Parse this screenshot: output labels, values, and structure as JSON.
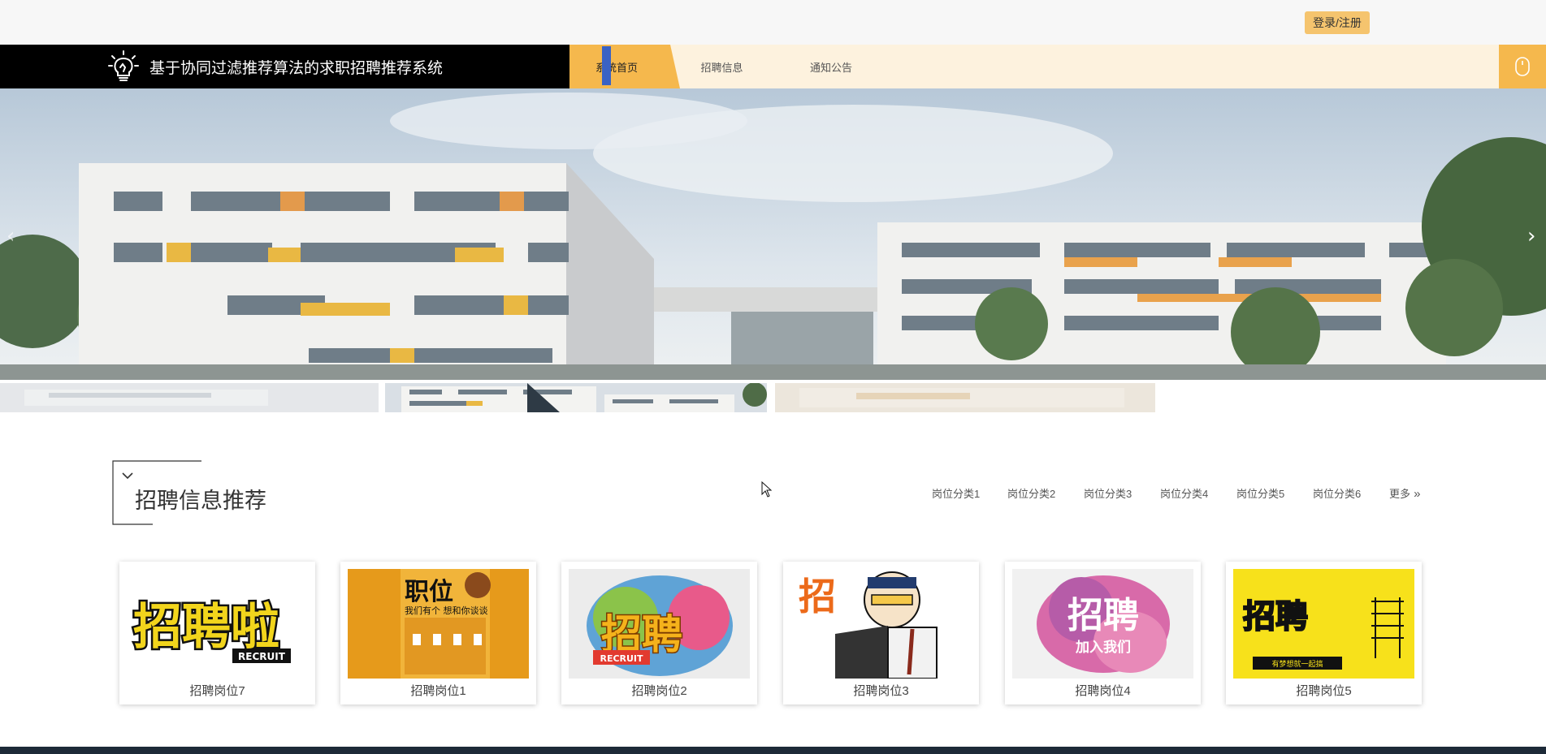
{
  "header": {
    "login_label": "登录/注册"
  },
  "nav": {
    "brand_title": "基于协同过滤推荐算法的求职招聘推荐系统",
    "tabs": [
      {
        "label": "系统首页",
        "active": true
      },
      {
        "label": "招聘信息",
        "active": false
      },
      {
        "label": "通知公告",
        "active": false
      }
    ]
  },
  "section": {
    "title": "招聘信息推荐",
    "categories": [
      "岗位分类1",
      "岗位分类2",
      "岗位分类3",
      "岗位分类4",
      "岗位分类5",
      "岗位分类6"
    ],
    "more_label": "更多"
  },
  "cards": [
    {
      "label": "招聘岗位7",
      "poster": "招聘啦",
      "sub": "RECRUIT"
    },
    {
      "label": "招聘岗位1",
      "poster": "职位",
      "sub": "我们有个 想和你谈谈"
    },
    {
      "label": "招聘岗位2",
      "poster": "招聘",
      "sub": "RECRUIT"
    },
    {
      "label": "招聘岗位3",
      "poster": "招",
      "sub": ""
    },
    {
      "label": "招聘岗位4",
      "poster": "招聘",
      "sub": "加入我们"
    },
    {
      "label": "招聘岗位5",
      "poster": "招聘",
      "sub": "有梦想就一起搞"
    }
  ],
  "colors": {
    "accent": "#f5b84d",
    "brand_bg": "#000000",
    "nav_bg": "#fdf2de"
  }
}
